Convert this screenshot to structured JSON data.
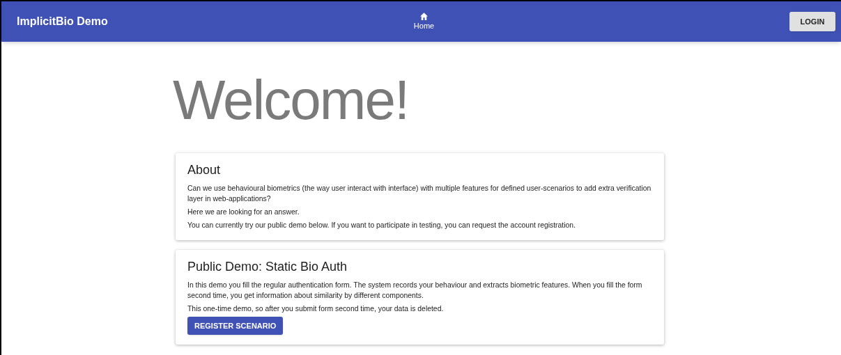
{
  "app_bar": {
    "title": "ImplicitBio Demo",
    "nav": [
      {
        "label": "Home",
        "selected": true
      }
    ],
    "login_button": "LOGIN"
  },
  "heading": "Welcome!",
  "cards": [
    {
      "title": "About",
      "paragraphs": [
        "Can we use behavioural biometrics (the way user interact with interface) with multiple features for defined user-scenarios to add extra verification layer in web-applications?",
        "Here we are looking for an answer.",
        "You can currently try our public demo below. If you want to participate in testing, you can request the account registration."
      ]
    },
    {
      "title": "Public Demo: Static Bio Auth",
      "paragraphs": [
        "In this demo you fill the regular authentication form. The system records your behaviour and extracts biometric features. When you fill the form second time, you get information about similarity by different components.",
        "This one-time demo, so after you submit form second time, your data is deleted."
      ],
      "button": "REGISTER SCENARIO"
    }
  ]
}
